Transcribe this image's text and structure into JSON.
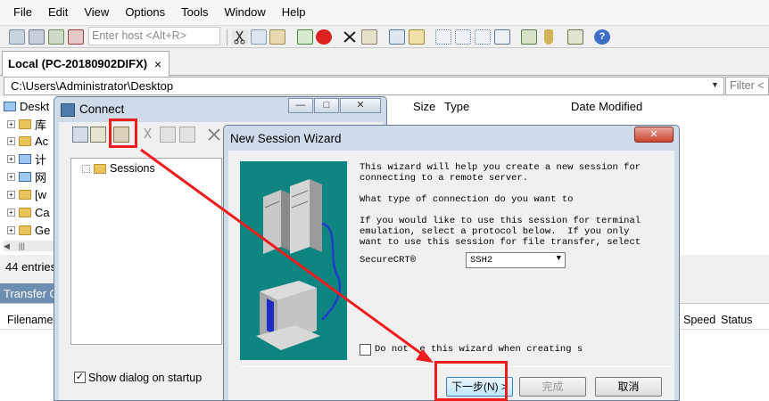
{
  "menu": [
    "File",
    "Edit",
    "View",
    "Options",
    "Tools",
    "Window",
    "Help"
  ],
  "toolbar": {
    "host_placeholder": "Enter host <Alt+R>"
  },
  "tab": {
    "label": "Local (PC-20180902DIFX)",
    "close": "×"
  },
  "path": {
    "value": "C:\\Users\\Administrator\\Desktop",
    "filter_placeholder": "Filter <"
  },
  "tree": [
    "Deskt",
    "库",
    "Ac",
    "计",
    "网",
    "[w",
    "Ca",
    "Ge"
  ],
  "file_columns": [
    "Size",
    "Type",
    "Date Modified"
  ],
  "status": {
    "entries": "44 entries"
  },
  "transfer": {
    "title": "Transfer Q",
    "columns": [
      "Filename",
      "Speed",
      "Status"
    ]
  },
  "connect_dialog": {
    "title": "Connect",
    "sessions_label": "Sessions",
    "show_dialog_label": "Show dialog on startup",
    "show_dialog_checked": true
  },
  "wizard": {
    "title": "New Session Wizard",
    "close": "✕",
    "intro": "This wizard will help you create a new session for\nconnecting to a remote server.\n\nWhat type of connection do you want to\n\nIf you would like to use this session for terminal\nemulation, select a protocol below.  If you only\nwant to use this session for file transfer, select",
    "protocol_label": "SecureCRT®",
    "protocol_value": "SSH2",
    "dont_use_label": "Do not  e this wizard when creating s",
    "next_button": "下一步(N) >",
    "finish_button": "完成",
    "cancel_button": "取消"
  },
  "colors": {
    "annotation_red": "#ee1c1c",
    "wizard_art_bg": "#0f8582",
    "titlebar_bg": "#cfdbe9"
  }
}
